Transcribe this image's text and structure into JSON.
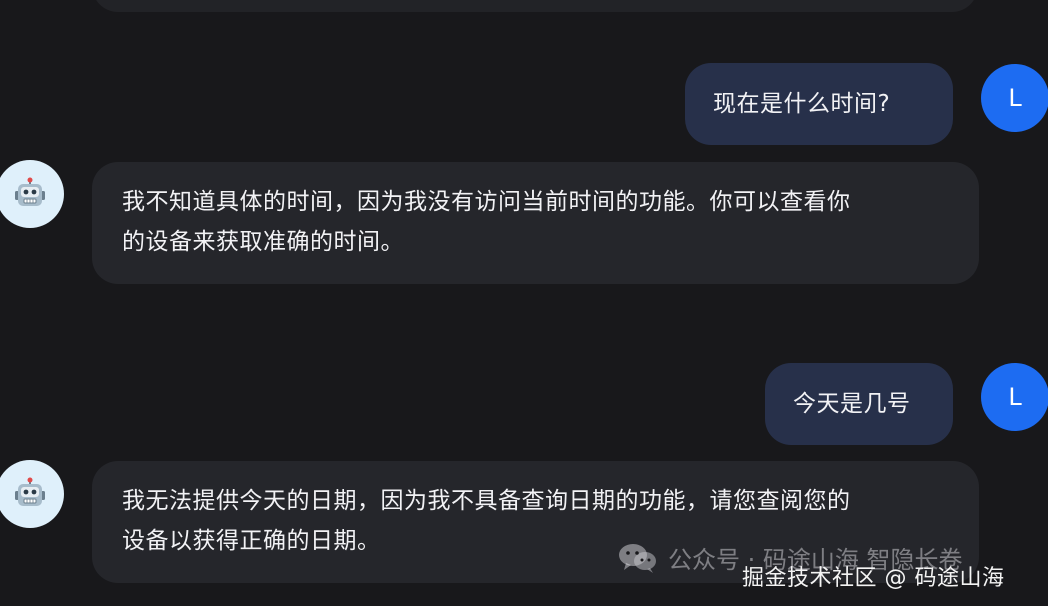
{
  "chat": {
    "messages": [
      {
        "role": "user",
        "avatar_letter": "L",
        "text": "现在是什么时间?"
      },
      {
        "role": "assistant",
        "avatar_icon": "robot-icon",
        "lines": [
          "我不知道具体的时间，因为我没有访问当前时间的功能。你可以查看你",
          "的设备来获取准确的时间。"
        ]
      },
      {
        "role": "user",
        "avatar_letter": "L",
        "text": "今天是几号"
      },
      {
        "role": "assistant",
        "avatar_icon": "robot-icon",
        "lines": [
          "我无法提供今天的日期，因为我不具备查询日期的功能，请您查阅您的",
          "设备以获得正确的日期。"
        ]
      }
    ]
  },
  "watermark": {
    "wechat_icon": "wechat-icon",
    "account": "公众号 · 码途山海 智隐长卷",
    "site": "掘金技术社区 @ 码途山海"
  },
  "colors": {
    "background": "#18181b",
    "user_bubble": "#27304a",
    "assistant_bubble": "#25262b",
    "user_avatar": "#1d6cf2",
    "bot_avatar_bg": "#dff0fb"
  }
}
